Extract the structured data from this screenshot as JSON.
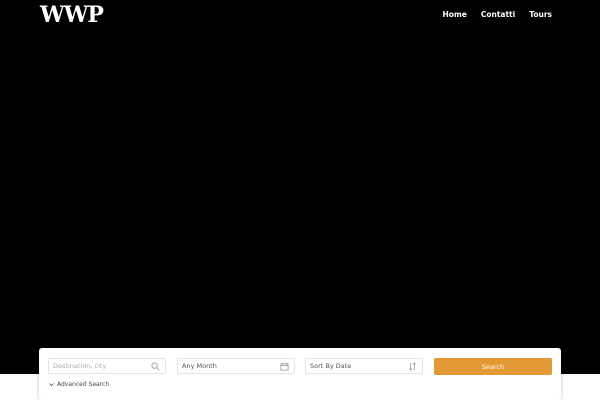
{
  "header": {
    "logo_text": "WWP",
    "nav": [
      {
        "label": "Home"
      },
      {
        "label": "Contatti"
      },
      {
        "label": "Tours"
      }
    ]
  },
  "search": {
    "destination_placeholder": "Destination, city",
    "month_value": "Any Month",
    "sort_value": "Sort By Date",
    "search_label": "Search",
    "advanced_label": "Advanced Search"
  },
  "colors": {
    "accent": "#e39a35",
    "background": "#000000"
  },
  "icons": {
    "destination": "search-icon",
    "month": "calendar-icon",
    "sort": "sort-icon",
    "advanced": "chevron-down-icon"
  }
}
